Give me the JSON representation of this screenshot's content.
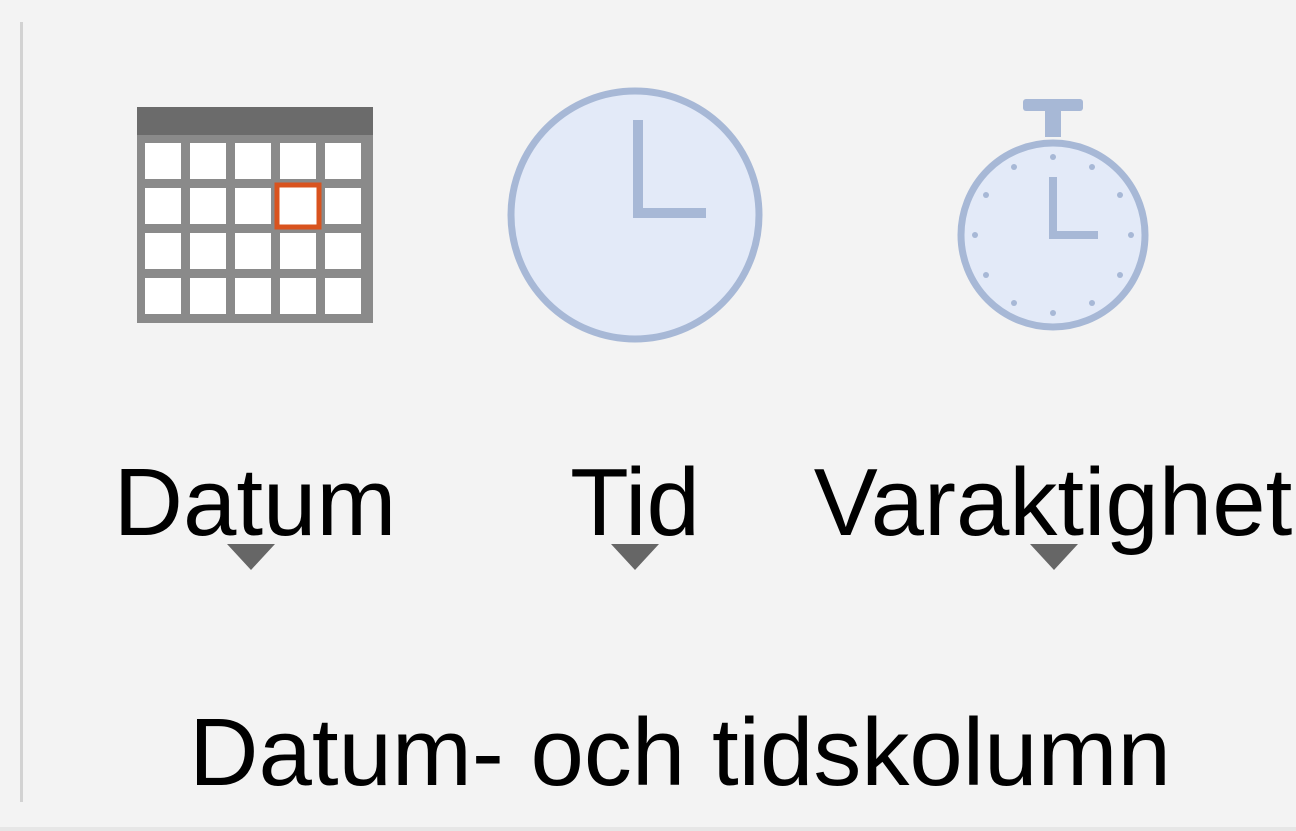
{
  "ribbon_group": {
    "label": "Datum- och tidskolumn",
    "buttons": [
      {
        "id": "datum",
        "label": "Datum",
        "icon": "calendar-icon",
        "has_dropdown": true
      },
      {
        "id": "tid",
        "label": "Tid",
        "icon": "clock-icon",
        "has_dropdown": true
      },
      {
        "id": "varaktighet",
        "label": "Varaktighet",
        "icon": "stopwatch-icon",
        "has_dropdown": true
      }
    ]
  },
  "colors": {
    "background": "#f3f3f3",
    "text": "#000000",
    "calendar_header": "#6b6b6b",
    "calendar_grid": "#8a8a8a",
    "calendar_highlight": "#d9531e",
    "clock_fill": "#e3eaf8",
    "clock_stroke": "#a7b8d6",
    "dropdown_arrow": "#666666"
  }
}
